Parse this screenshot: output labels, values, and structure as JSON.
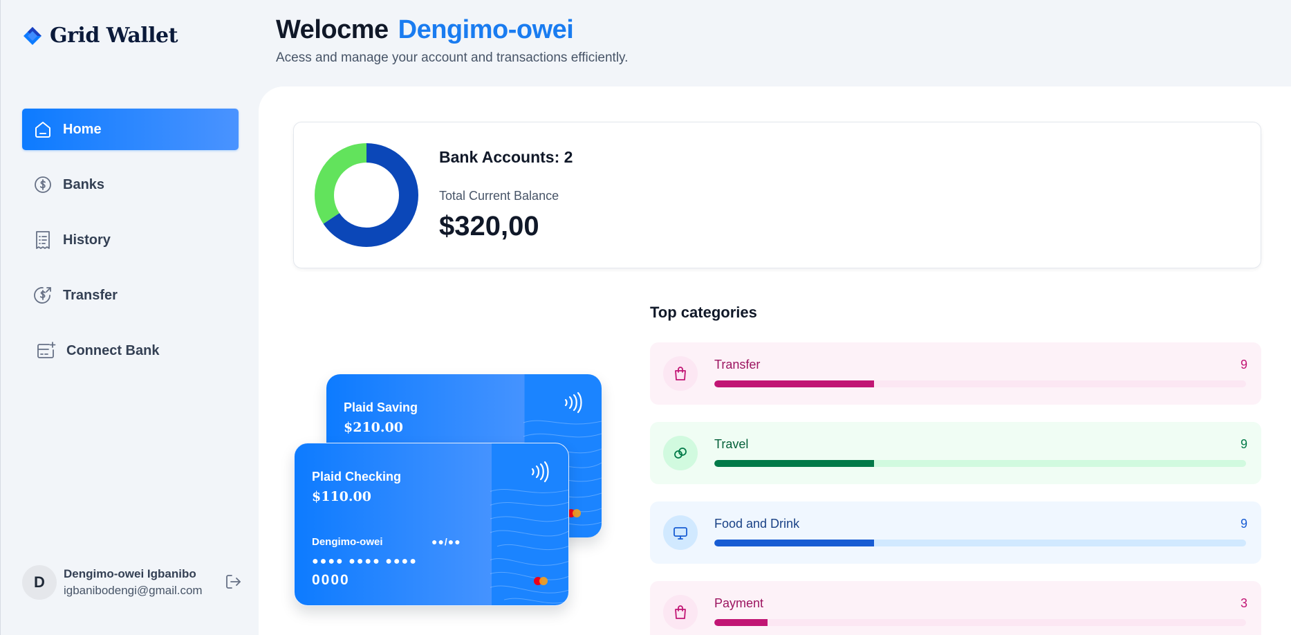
{
  "app": {
    "logo_text": "Grid Wallet",
    "brand_color": "#0d7bff"
  },
  "sidebar": {
    "items": [
      {
        "label": "Home",
        "icon": "home-icon",
        "active": true
      },
      {
        "label": "Banks",
        "icon": "dollar-circle-icon",
        "active": false
      },
      {
        "label": "History",
        "icon": "receipt-icon",
        "active": false
      },
      {
        "label": "Transfer",
        "icon": "money-send-icon",
        "active": false
      },
      {
        "label": "Connect Bank",
        "icon": "card-add-icon",
        "active": false
      }
    ]
  },
  "user": {
    "initial": "D",
    "name": "Dengimo-owei Igbanibo",
    "email": "igbanibodengi@gmail.com"
  },
  "header": {
    "greeting": "Welocme",
    "name": "Dengimo-owei",
    "subtitle": "Acess and manage your account and transactions efficiently."
  },
  "balance": {
    "accounts_label": "Bank Accounts: 2",
    "total_label": "Total Current Balance",
    "total_value": "$320,00",
    "donut": [
      {
        "name": "Plaid Saving",
        "value": 210,
        "color": "#0b47b8"
      },
      {
        "name": "Plaid Checking",
        "value": 110,
        "color": "#62e35c"
      }
    ]
  },
  "cards": [
    {
      "name": "Plaid Saving",
      "amount": "$210.00"
    },
    {
      "name": "Plaid Checking",
      "amount": "$110.00",
      "holder": "Dengimo-owei",
      "expiry": "●●/●●",
      "number": "●●●● ●●●● ●●●●",
      "last4": "0000"
    }
  ],
  "categories": {
    "title": "Top categories",
    "items": [
      {
        "name": "Transfer",
        "count": "9",
        "progress": 0.3,
        "icon": "shopping-bag-icon",
        "bg": "#fdf2f8",
        "track": "#fce7f3",
        "fill": "#c11574",
        "text": "#9c1560",
        "circle": "#fce7f3"
      },
      {
        "name": "Travel",
        "count": "9",
        "progress": 0.3,
        "icon": "link-icon",
        "bg": "#f0fdf4",
        "track": "#d1fadf",
        "fill": "#027a48",
        "text": "#05603a",
        "circle": "#d1fadf"
      },
      {
        "name": "Food and Drink",
        "count": "9",
        "progress": 0.3,
        "icon": "monitor-icon",
        "bg": "#f0f7ff",
        "track": "#d1e9ff",
        "fill": "#175cd3",
        "text": "#194185",
        "circle": "#d1e9ff"
      },
      {
        "name": "Payment",
        "count": "3",
        "progress": 0.1,
        "icon": "shopping-bag-icon",
        "bg": "#fdf2f8",
        "track": "#fce7f3",
        "fill": "#c11574",
        "text": "#9c1560",
        "circle": "#fce7f3"
      }
    ]
  }
}
